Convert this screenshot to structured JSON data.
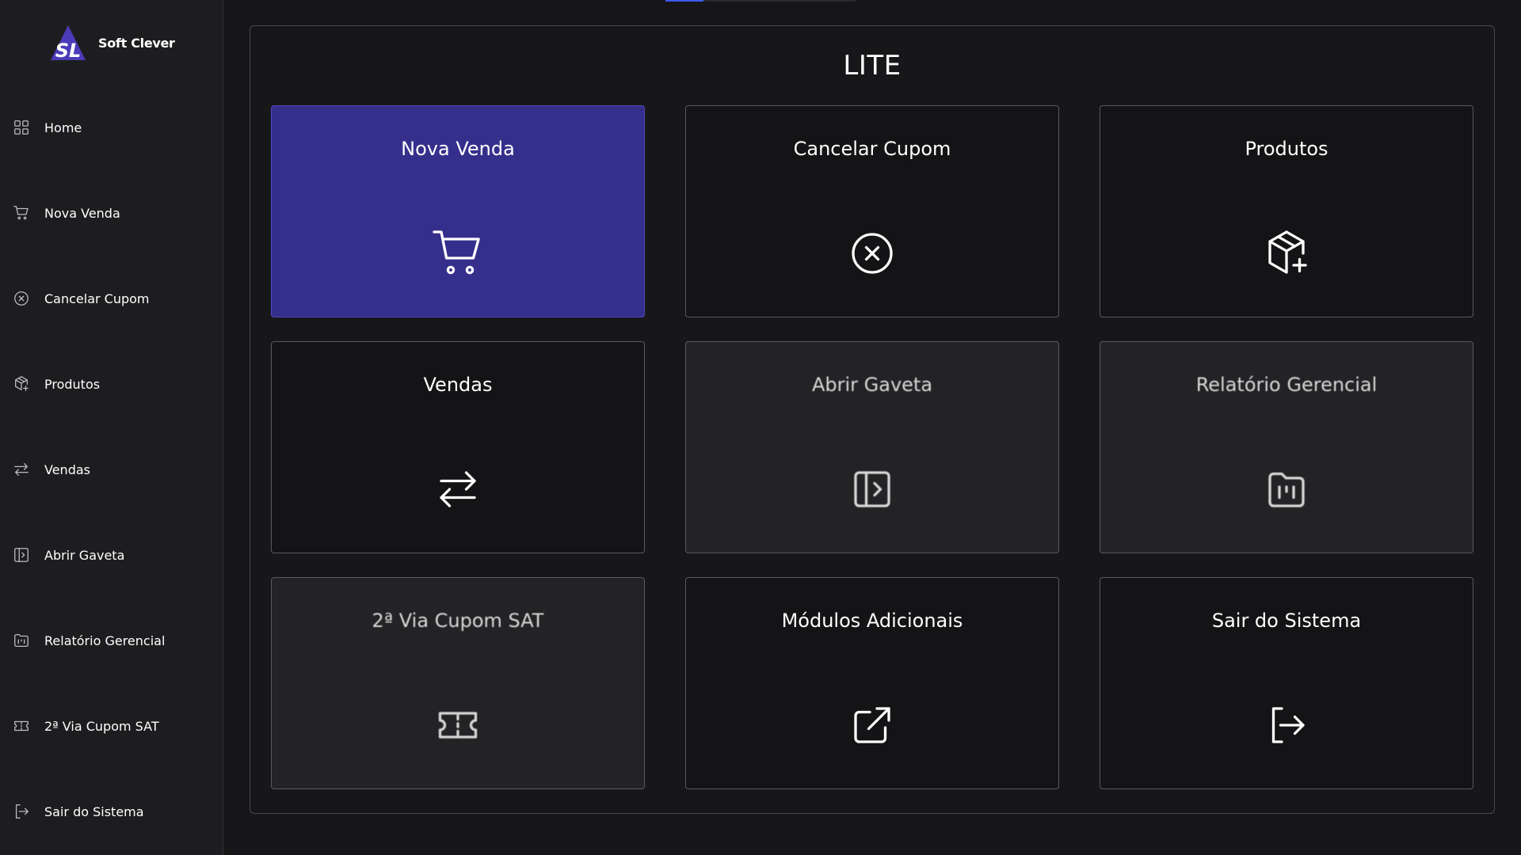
{
  "brand": {
    "name": "Soft Clever",
    "logo_letters": "SL"
  },
  "sidebar": {
    "items": [
      {
        "label": "Home",
        "icon": "grid-icon"
      },
      {
        "label": "Nova Venda",
        "icon": "cart-icon"
      },
      {
        "label": "Cancelar Cupom",
        "icon": "x-circle-icon"
      },
      {
        "label": "Produtos",
        "icon": "box-plus-icon"
      },
      {
        "label": "Vendas",
        "icon": "arrows-exchange-icon"
      },
      {
        "label": "Abrir Gaveta",
        "icon": "drawer-icon"
      },
      {
        "label": "Relatório Gerencial",
        "icon": "folder-chart-icon"
      },
      {
        "label": "2ª Via Cupom SAT",
        "icon": "ticket-icon"
      },
      {
        "label": "Sair do Sistema",
        "icon": "logout-icon"
      }
    ]
  },
  "main": {
    "title": "LITE",
    "cards": [
      {
        "label": "Nova Venda",
        "icon": "cart-icon"
      },
      {
        "label": "Cancelar Cupom",
        "icon": "x-circle-icon"
      },
      {
        "label": "Produtos",
        "icon": "box-plus-icon"
      },
      {
        "label": "Vendas",
        "icon": "arrows-exchange-icon"
      },
      {
        "label": "Abrir Gaveta",
        "icon": "drawer-icon"
      },
      {
        "label": "Relatório Gerencial",
        "icon": "folder-chart-icon"
      },
      {
        "label": "2ª Via Cupom SAT",
        "icon": "ticket-icon"
      },
      {
        "label": "Módulos Adicionais",
        "icon": "external-link-icon"
      },
      {
        "label": "Sair do Sistema",
        "icon": "logout-icon"
      }
    ]
  },
  "colors": {
    "primary_card": "#352f8c",
    "background": "#161618",
    "sidebar": "#1d1d20",
    "accent": "#3d5af1"
  }
}
